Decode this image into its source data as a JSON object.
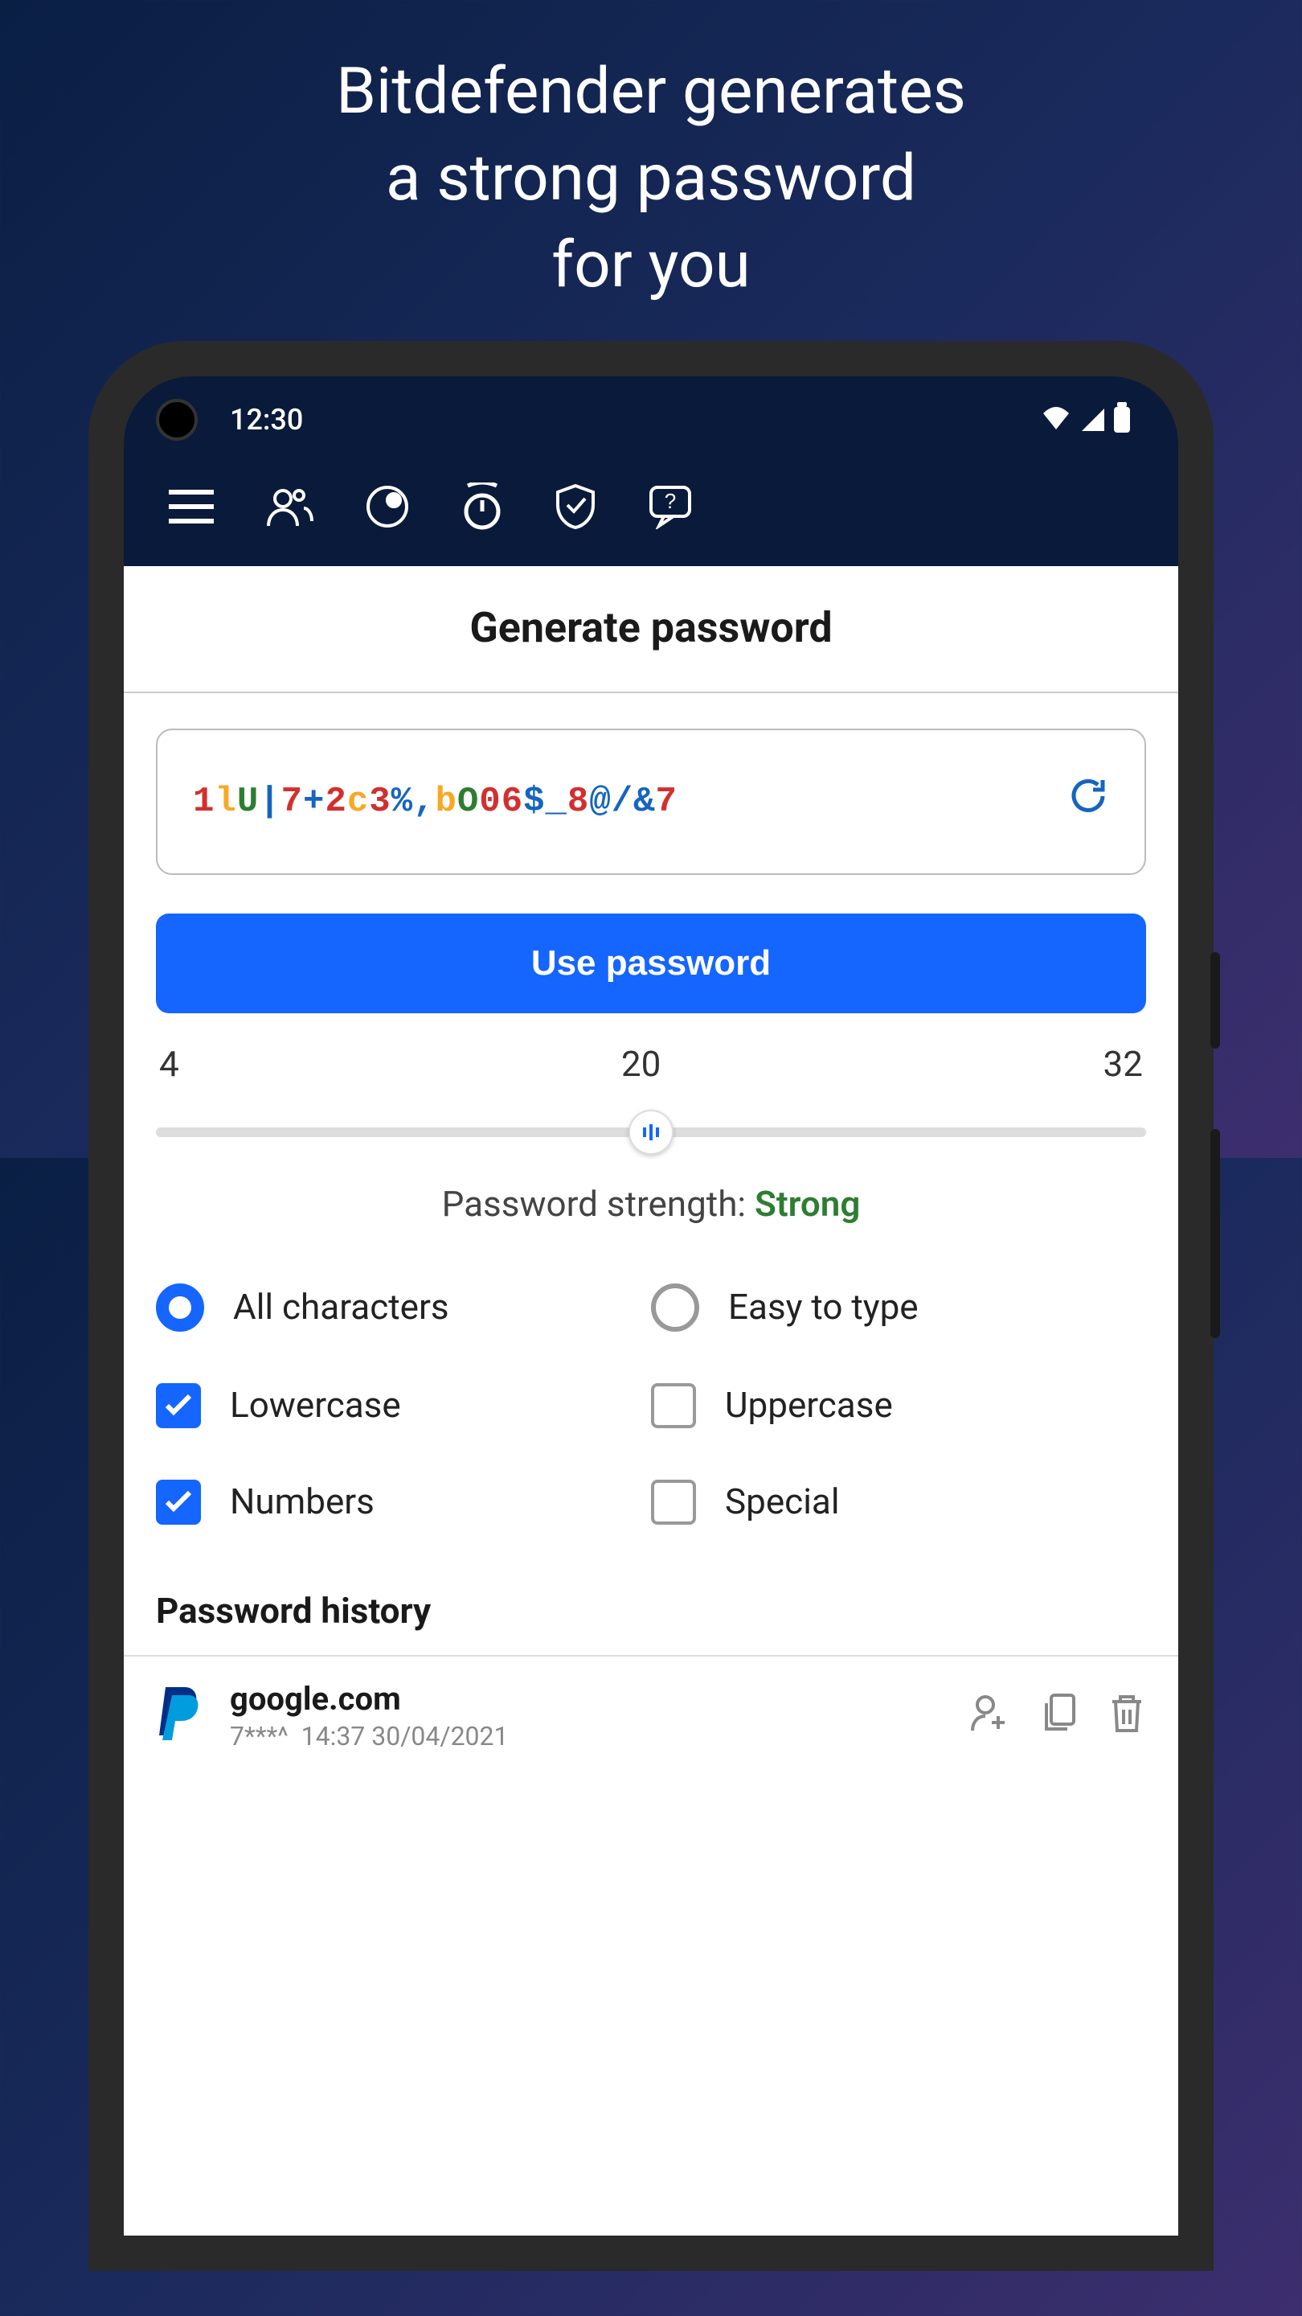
{
  "promo": {
    "line1": "Bitdefender generates",
    "line2": "a strong password",
    "line3": "for you"
  },
  "status": {
    "time": "12:30"
  },
  "page": {
    "title": "Generate password"
  },
  "password": {
    "chars": [
      {
        "c": "1",
        "cls": "c-red"
      },
      {
        "c": "l",
        "cls": "c-gold"
      },
      {
        "c": "U",
        "cls": "c-green"
      },
      {
        "c": "|",
        "cls": "c-blue"
      },
      {
        "c": "7",
        "cls": "c-red"
      },
      {
        "c": "+",
        "cls": "c-blue"
      },
      {
        "c": "2",
        "cls": "c-red"
      },
      {
        "c": "c",
        "cls": "c-gold"
      },
      {
        "c": "3",
        "cls": "c-red"
      },
      {
        "c": "%",
        "cls": "c-blue"
      },
      {
        "c": ",",
        "cls": "c-blue"
      },
      {
        "c": "b",
        "cls": "c-gold"
      },
      {
        "c": "O",
        "cls": "c-green"
      },
      {
        "c": "0",
        "cls": "c-red"
      },
      {
        "c": "6",
        "cls": "c-red"
      },
      {
        "c": "$",
        "cls": "c-blue"
      },
      {
        "c": "_",
        "cls": "c-blue"
      },
      {
        "c": "8",
        "cls": "c-red"
      },
      {
        "c": "@",
        "cls": "c-blue"
      },
      {
        "c": "/",
        "cls": "c-blue"
      },
      {
        "c": "&",
        "cls": "c-blue"
      },
      {
        "c": "7",
        "cls": "c-red"
      }
    ]
  },
  "buttons": {
    "use": "Use password"
  },
  "slider": {
    "min": "4",
    "mid": "20",
    "max": "32"
  },
  "strength": {
    "label": "Password strength: ",
    "value": "Strong"
  },
  "options": {
    "all_chars": "All characters",
    "easy": "Easy to type",
    "lowercase": "Lowercase",
    "uppercase": "Uppercase",
    "numbers": "Numbers",
    "special": "Special"
  },
  "history": {
    "title": "Password history",
    "items": [
      {
        "domain": "google.com",
        "masked": "7***^",
        "datetime": "14:37 30/04/2021"
      }
    ]
  }
}
